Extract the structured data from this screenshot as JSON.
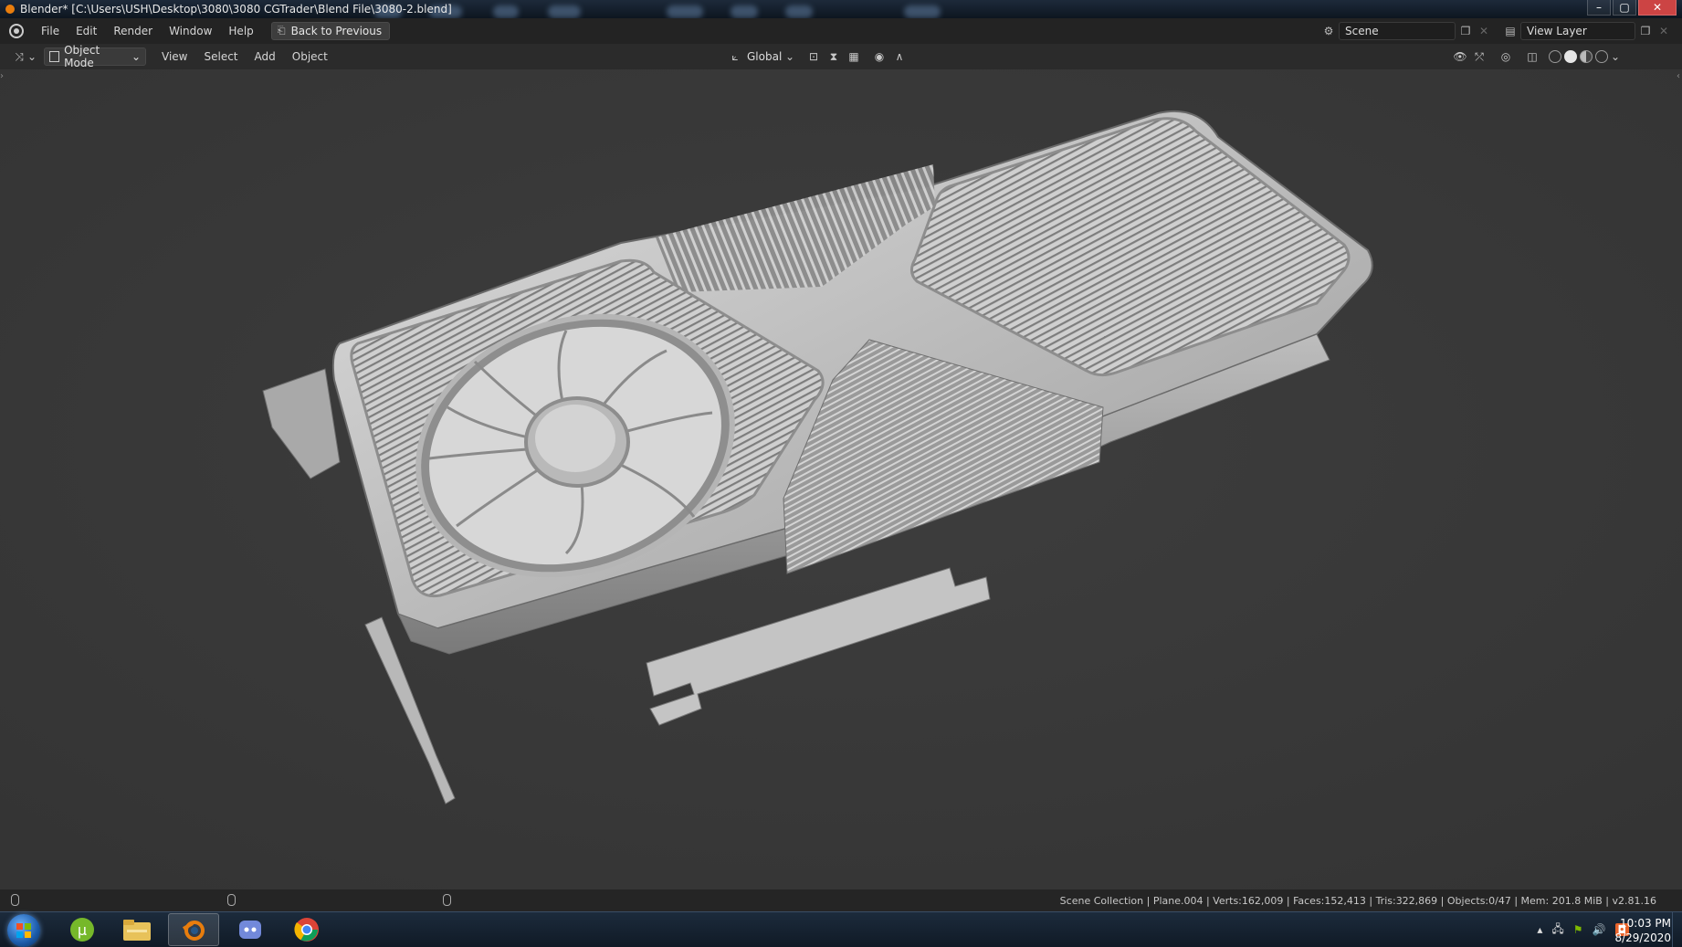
{
  "titlebar": {
    "title": "Blender* [C:\\Users\\USH\\Desktop\\3080\\3080 CGTrader\\Blend File\\3080-2.blend]",
    "buttons": [
      "–",
      "▢",
      "✕"
    ]
  },
  "topbar": {
    "menus": [
      "File",
      "Edit",
      "Render",
      "Window",
      "Help"
    ],
    "back_button": "Back to Previous",
    "scene_label": "Scene",
    "view_layer_label": "View Layer"
  },
  "viewport_header": {
    "mode": "Object Mode",
    "menus": [
      "View",
      "Select",
      "Add",
      "Object"
    ],
    "transform_orientation": "Global",
    "shading_mode": "solid"
  },
  "viewport": {
    "object": "graphics-card-model"
  },
  "statusbar": {
    "stats": "Scene Collection | Plane.004 | Verts:162,009 | Faces:152,413 | Tris:322,869 | Objects:0/47 | Mem: 201.8 MiB | v2.81.16"
  },
  "taskbar": {
    "apps": [
      "utorrent-icon",
      "file-explorer-icon",
      "blender-icon",
      "discord-icon",
      "chrome-icon"
    ],
    "active_app": "blender-icon",
    "time": "10:03 PM",
    "date": "8/29/2020"
  },
  "colors": {
    "viewport_bg": "#3a3a3a",
    "model": "#c9c9c9",
    "header": "#232323",
    "accent": "#e87d0d"
  }
}
